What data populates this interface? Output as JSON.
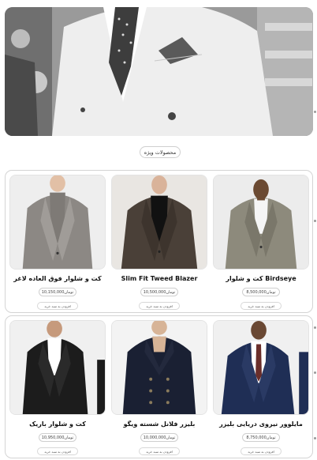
{
  "hero": {
    "image": "man-in-white-suit-banner"
  },
  "special_button": {
    "label": "محصولات ویژه"
  },
  "sections": [
    {
      "products": [
        {
          "name": "کت و شلوار Birdseye",
          "price": "8,500,000تومان",
          "cart": "افزودن به سبد خرید",
          "image": "grey-check-suit"
        },
        {
          "name": "Slim Fit Tweed Blazer",
          "price": "10,500,000تومان",
          "cart": "افزودن به سبد خرید",
          "image": "brown-tweed-blazer"
        },
        {
          "name": "کت و شلوار فوق العاده لاغر",
          "price": "10,150,000تومان",
          "cart": "افزودن به سبد خرید",
          "image": "grey-suit-turtleneck"
        }
      ]
    },
    {
      "products": [
        {
          "name": "مایلوور نیروی دریایی بلیزر",
          "price": "8,750,000تومان",
          "cart": "افزودن به سبد خرید",
          "image": "navy-blazer"
        },
        {
          "name": "بلیزر فلانل شسته ویگو",
          "price": "10,000,000تومان",
          "cart": "افزودن به سبد خرید",
          "image": "navy-double-breasted"
        },
        {
          "name": "کت و شلوار باریک",
          "price": "10,950,000تومان",
          "cart": "افزودن به سبد خرید",
          "image": "black-slim-suit"
        }
      ]
    }
  ]
}
